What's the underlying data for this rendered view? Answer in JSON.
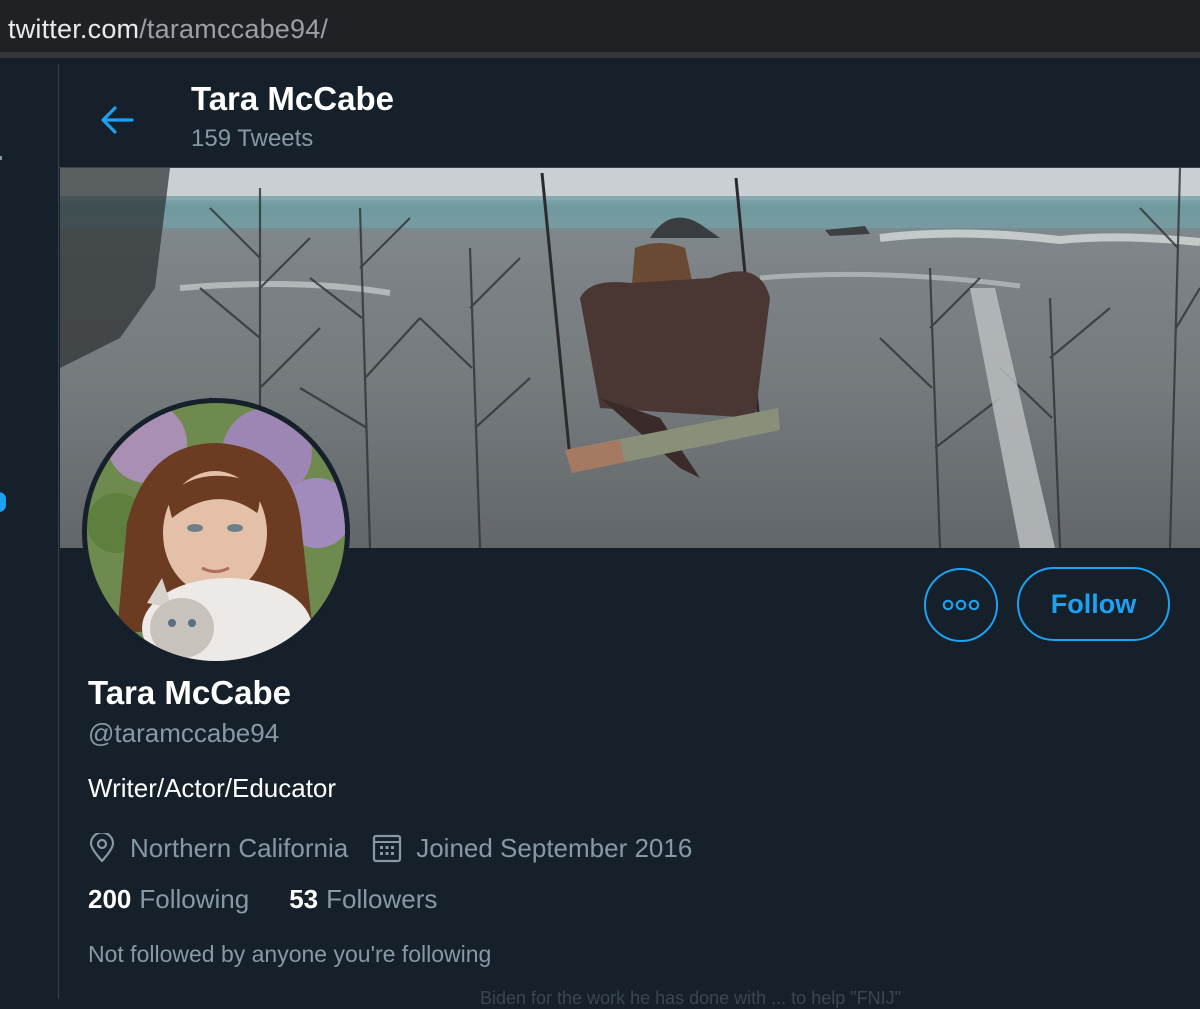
{
  "browser": {
    "url_host": "twitter.com",
    "url_path": "/taramccabe94/"
  },
  "header": {
    "name": "Tara McCabe",
    "tweet_count": "159 Tweets"
  },
  "profile": {
    "name": "Tara McCabe",
    "handle": "@taramccabe94",
    "bio": "Writer/Actor/Educator",
    "location": "Northern California",
    "joined": "Joined September 2016",
    "following_count": "200",
    "following_label": "Following",
    "followers_count": "53",
    "followers_label": "Followers",
    "not_followed_note": "Not followed by anyone you're following"
  },
  "actions": {
    "follow_label": "Follow"
  },
  "footer_fragment": "Biden for the work he has done with ... to help \"FNIJ\"",
  "icons": {
    "back": "arrow-left-icon",
    "more": "more-icon",
    "location": "location-pin-icon",
    "calendar": "calendar-icon"
  },
  "colors": {
    "background": "#15202b",
    "accent": "#1da1f2",
    "secondary_text": "#8899a6",
    "border": "#38444d"
  }
}
